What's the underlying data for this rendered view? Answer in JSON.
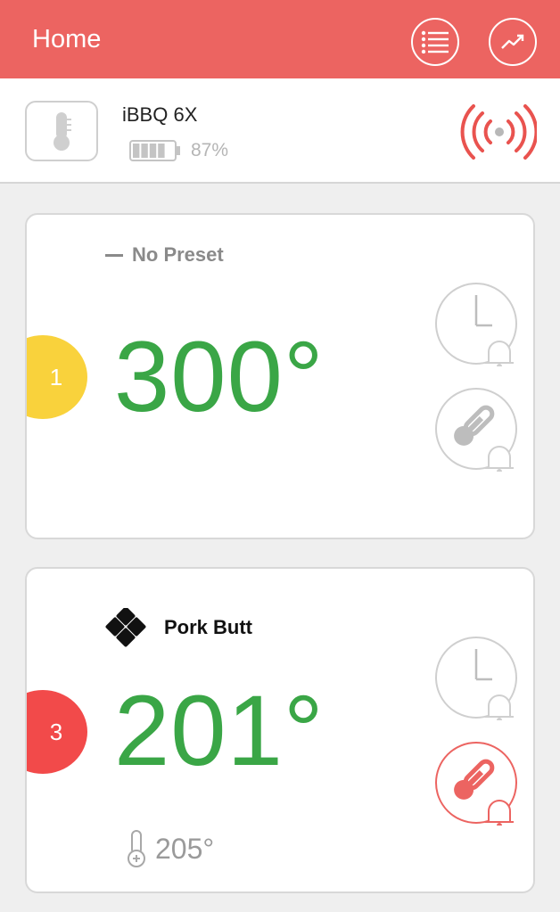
{
  "header": {
    "title": "Home",
    "menu_icon": "list-icon",
    "chart_icon": "trend-chart-icon"
  },
  "device": {
    "name": "iBBQ 6X",
    "battery_percent": "87%",
    "battery_level": 0.87,
    "status_icon": "broadcast-signal-icon"
  },
  "probes": [
    {
      "number": "1",
      "color": "#f9d23c",
      "preset": "No Preset",
      "temperature": "300°"
    },
    {
      "number": "3",
      "color": "#f24a4a",
      "preset": "Pork Butt",
      "temperature": "201°",
      "target_temperature": "205°"
    }
  ],
  "colors": {
    "accent": "#ec6461",
    "temp_green": "#3aa646",
    "alarm_active": "#ec6461",
    "alarm_inactive": "#c9c9c9"
  }
}
